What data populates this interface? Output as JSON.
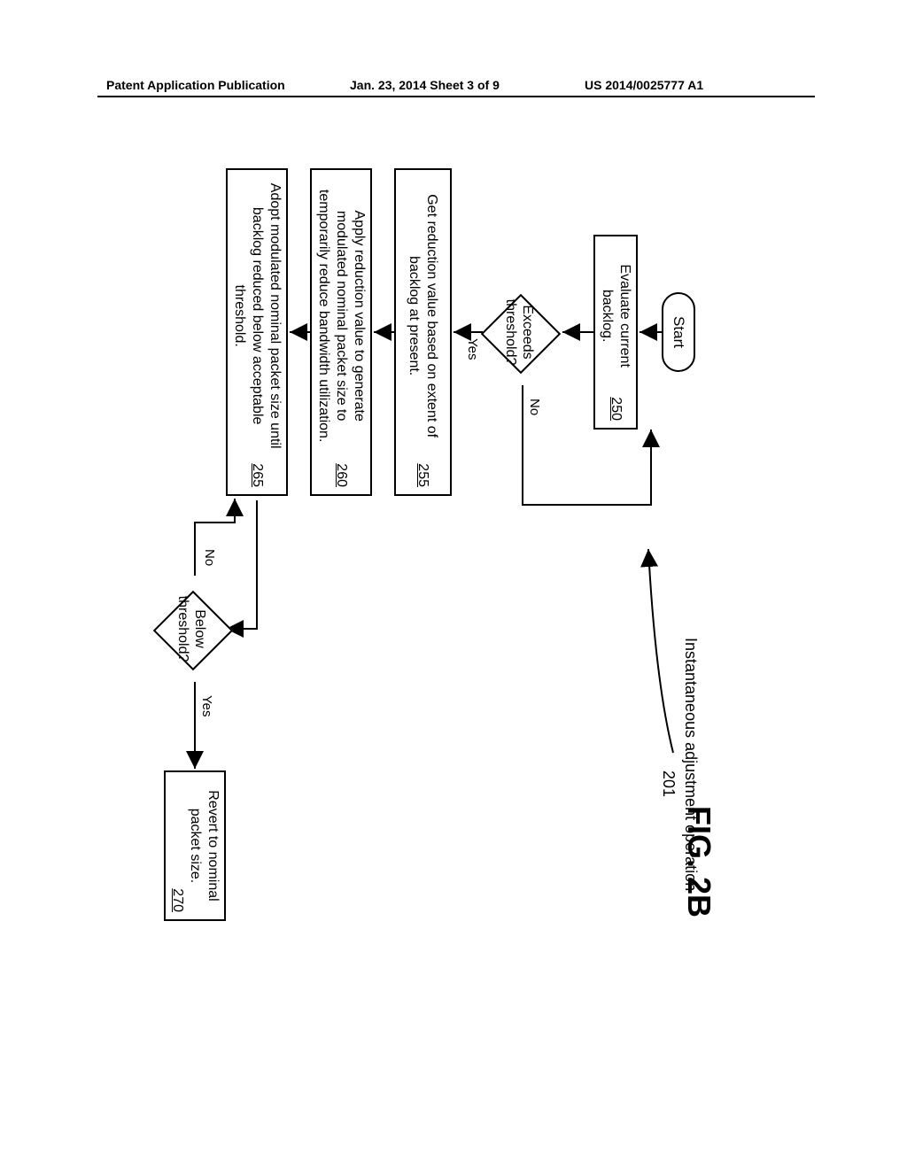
{
  "header": {
    "left": "Patent Application Publication",
    "center": "Jan. 23, 2014   Sheet 3 of 9",
    "right": "US 2014/0025777 A1"
  },
  "figure": {
    "label": "FIG. 2B",
    "subtitle": "Instantaneous adjustment operation",
    "subtitle_ref": "201"
  },
  "flow": {
    "start": "Start",
    "b250": {
      "text": "Evaluate current backlog.",
      "ref": "250"
    },
    "d1": {
      "text": "Exceeds threshold?",
      "yes": "Yes",
      "no": "No"
    },
    "b255": {
      "text": "Get reduction value based on extent of backlog at present.",
      "ref": "255"
    },
    "b260": {
      "text": "Apply reduction value to generate modulated nominal packet size to temporarily reduce bandwidth utilization.",
      "ref": "260"
    },
    "b265": {
      "text": "Adopt modulated nominal packet size until backlog reduced below acceptable threshold.",
      "ref": "265"
    },
    "d2": {
      "text": "Below threshold?",
      "yes": "Yes",
      "no": "No"
    },
    "b270": {
      "text": "Revert to nominal packet size.",
      "ref": "270"
    }
  }
}
